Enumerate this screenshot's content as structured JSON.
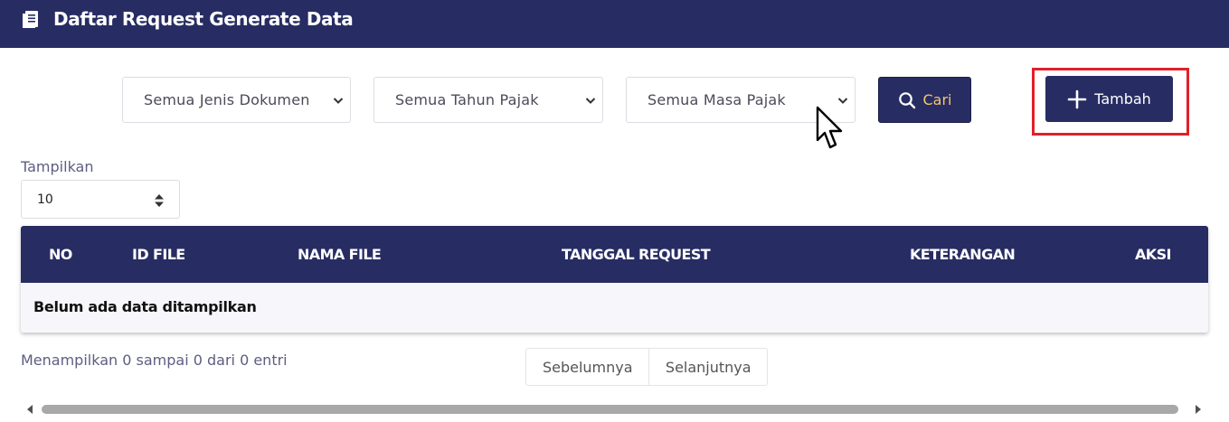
{
  "header": {
    "title": "Daftar Request Generate Data",
    "icon": "document-icon"
  },
  "filters": {
    "jenis_dokumen": "Semua Jenis Dokumen",
    "tahun_pajak": "Semua Tahun Pajak",
    "masa_pajak": "Semua Masa Pajak",
    "search_label": "Cari",
    "add_label": "Tambah"
  },
  "length_menu": {
    "label": "Tampilkan",
    "value": "10"
  },
  "table": {
    "columns": [
      "NO",
      "ID FILE",
      "NAMA FILE",
      "TANGGAL REQUEST",
      "KETERANGAN",
      "AKSI"
    ],
    "empty_message": "Belum ada data ditampilkan"
  },
  "footer": {
    "info": "Menampilkan 0 sampai 0 dari 0 entri",
    "prev_label": "Sebelumnya",
    "next_label": "Selanjutnya"
  },
  "colors": {
    "primary": "#272d63",
    "search_text": "#f3c56a",
    "highlight": "#e0202a",
    "muted_text": "#5d5d82"
  }
}
